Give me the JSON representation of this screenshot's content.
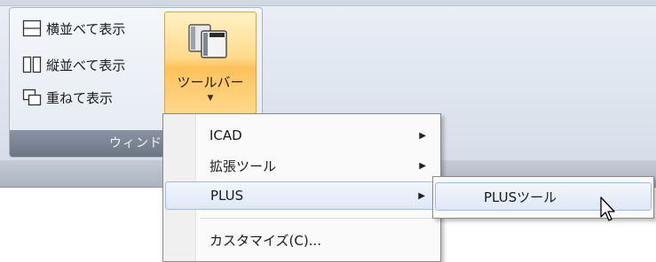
{
  "window_group": {
    "tile_horizontal_label": "横並べて表示",
    "tile_vertical_label": "縦並べて表示",
    "cascade_label": "重ねて表示",
    "group_title": "ウィンド"
  },
  "toolbar_button": {
    "label": "ツールバー",
    "arrow": "▼"
  },
  "toolbar_menu": {
    "items": [
      {
        "label": "ICAD",
        "submenu_arrow": "▶"
      },
      {
        "label": "拡張ツール",
        "submenu_arrow": "▶"
      },
      {
        "label": "PLUS",
        "submenu_arrow": "▶"
      },
      {
        "label": "カスタマイズ(C)..."
      }
    ]
  },
  "plus_submenu": {
    "items": [
      {
        "label": "PLUSツール"
      }
    ]
  },
  "colors": {
    "ribbon_bg": "#dfe6f0",
    "button_active": "#ffc25a",
    "menu_highlight": "#dde8f7",
    "group_footer": "#7a8493"
  },
  "icons": [
    "tile-horizontal-icon",
    "tile-vertical-icon",
    "cascade-icon",
    "toolbar-icon",
    "mouse-cursor-icon"
  ]
}
